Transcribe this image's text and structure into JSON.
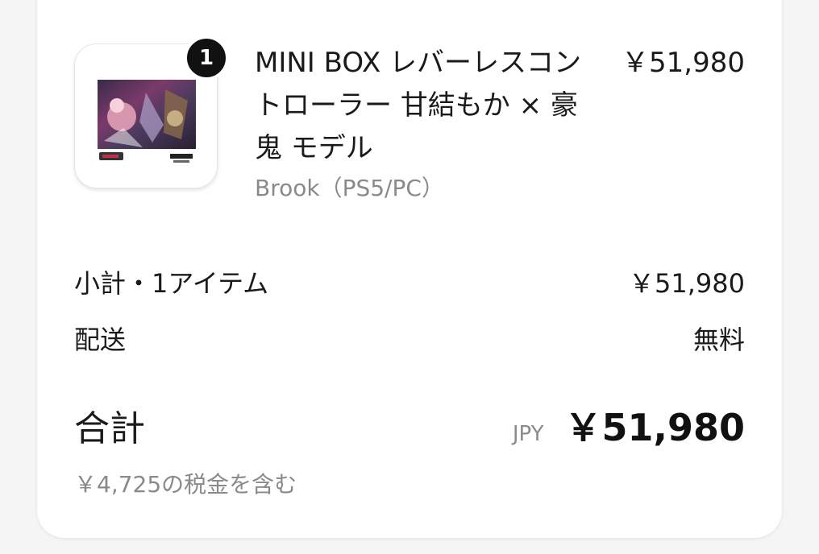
{
  "product": {
    "quantity": "1",
    "title": "MINI BOX レバーレスコントローラー 甘結もか × 豪鬼 モデル",
    "variant": "Brook（PS5/PC）",
    "price": "￥51,980",
    "thumbnail_icon": "product-image"
  },
  "summary": {
    "subtotal_label": "小計・1アイテム",
    "subtotal_value": "￥51,980",
    "shipping_label": "配送",
    "shipping_value": "無料",
    "total_label": "合計",
    "currency": "JPY",
    "total_value": "￥51,980",
    "tax_note": "￥4,725の税金を含む"
  }
}
